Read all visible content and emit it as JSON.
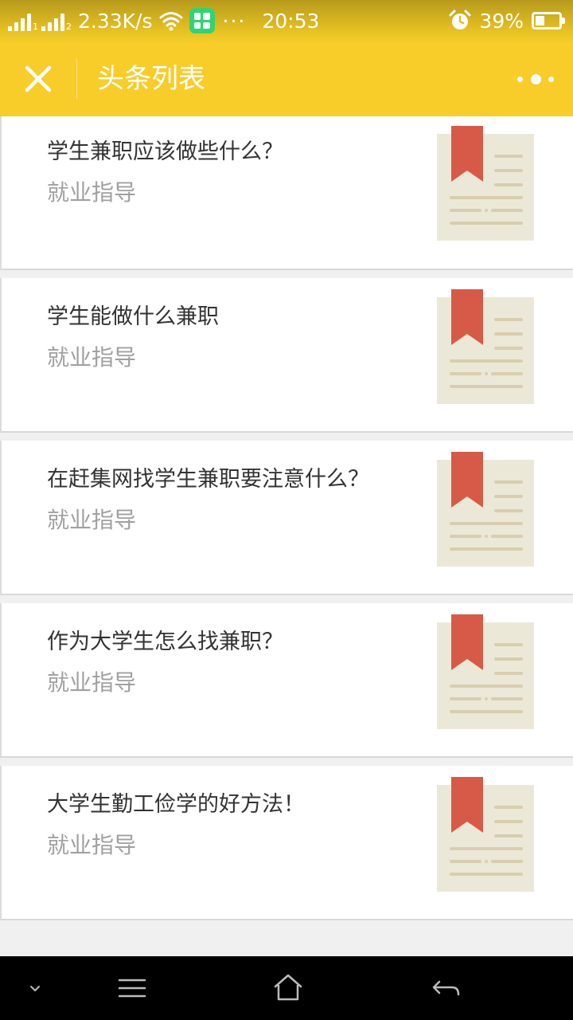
{
  "status_bar": {
    "sim1": "1",
    "sim2": "2",
    "speed": "2.33K/s",
    "dots": "···",
    "time": "20:53",
    "battery": "39%",
    "battery_level": 0.39
  },
  "nav_bar": {
    "title": "头条列表"
  },
  "articles": [
    {
      "title": "学生兼职应该做些什么？",
      "tag": "就业指导"
    },
    {
      "title": "学生能做什么兼职",
      "tag": "就业指导"
    },
    {
      "title": "在赶集网找学生兼职要注意什么？",
      "tag": "就业指导"
    },
    {
      "title": "作为大学生怎么找兼职？",
      "tag": "就业指导"
    },
    {
      "title": "大学生勤工俭学的好方法！",
      "tag": "就业指导"
    }
  ],
  "icons": {
    "close": "close-icon",
    "more": "more-icon",
    "thumbnail": "bookmark-document-icon",
    "sys_down": "chevron-down-icon",
    "sys_menu": "menu-icon",
    "sys_home": "home-icon",
    "sys_back": "back-icon"
  },
  "colors": {
    "accent": "#f8cd2a",
    "bookmark": "#d65a47",
    "paper": "#ece8d8",
    "lines": "#d8ceaf"
  }
}
